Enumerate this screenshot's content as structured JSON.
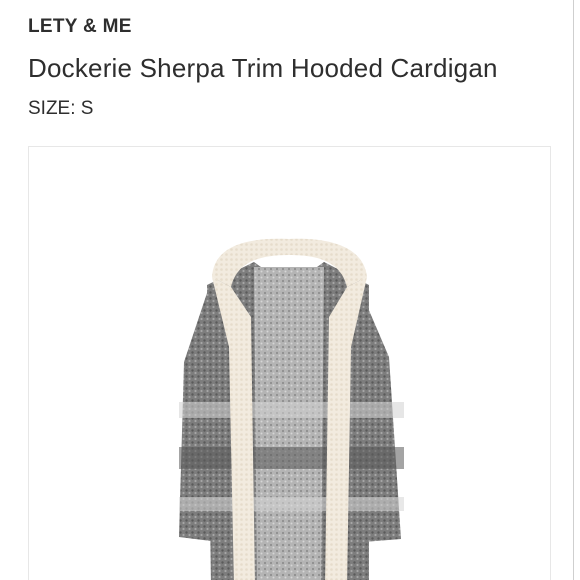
{
  "listing": {
    "brand": "LETY & ME",
    "title": "Dockerie Sherpa Trim Hooded Cardigan",
    "size_text": "SIZE: S"
  },
  "image": {
    "subject": "cardigan-photo",
    "colors": {
      "knit_dark": "#5e5e5e",
      "knit_mid": "#8a8a8a",
      "knit_light": "#bdbdbd",
      "sherpa": "#f3ede3"
    }
  }
}
